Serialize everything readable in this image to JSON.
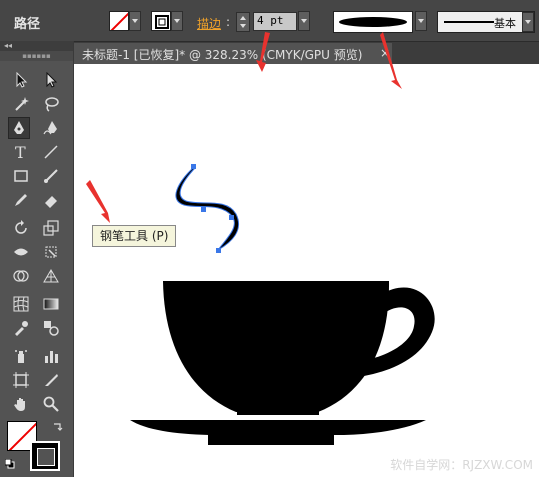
{
  "control_bar": {
    "path_label": "路径",
    "stroke_label": "描边",
    "stroke_colon": ":",
    "stroke_weight": "4 pt",
    "brush_label": "基本"
  },
  "document": {
    "tab_title": "未标题-1 [已恢复]* @ 328.23% (CMYK/GPU 预览)",
    "close_glyph": "×"
  },
  "tooltip": {
    "text": "钢笔工具 (P)"
  },
  "watermark": {
    "text": "软件自学网：RJZXW.COM"
  },
  "colors": {
    "panel": "#535353",
    "control_bar": "#464646",
    "stroke_label": "#f0a22a",
    "annotation_arrow": "#e8322e",
    "anchor": "#3a77e8"
  },
  "tools": [
    "selection-tool",
    "direct-selection-tool",
    "magic-wand-tool",
    "lasso-tool",
    "pen-tool",
    "curvature-tool",
    "type-tool",
    "line-segment-tool",
    "rectangle-tool",
    "paintbrush-tool",
    "pencil-tool",
    "eraser-tool",
    "rotate-tool",
    "scale-tool",
    "width-tool",
    "free-transform-tool",
    "shape-builder-tool",
    "perspective-grid-tool",
    "mesh-tool",
    "gradient-tool",
    "eyedropper-tool",
    "blend-tool",
    "symbol-sprayer-tool",
    "column-graph-tool",
    "artboard-tool",
    "slice-tool",
    "hand-tool",
    "zoom-tool"
  ]
}
